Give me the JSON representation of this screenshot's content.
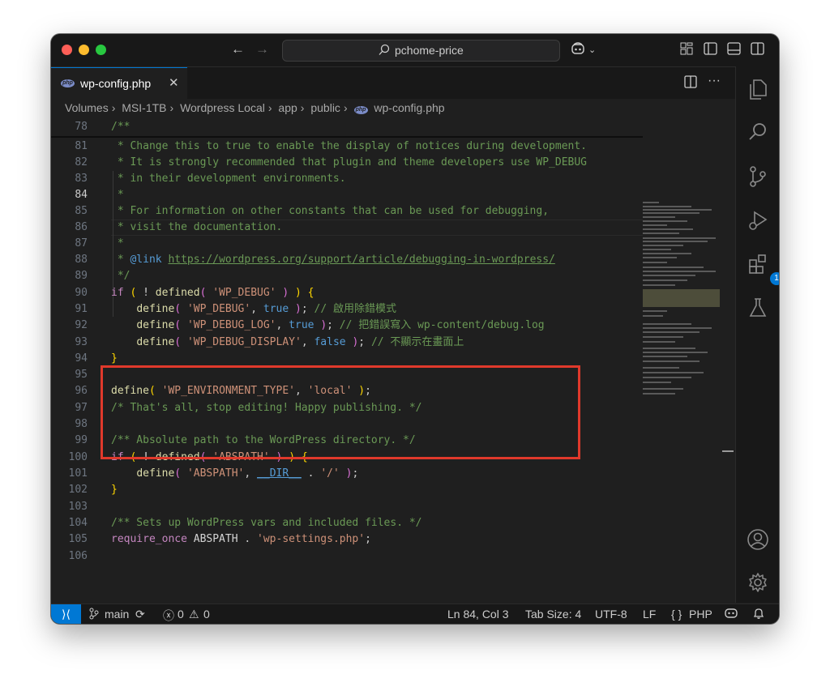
{
  "titlebar": {
    "search_text": "pchome-price",
    "back_icon": "arrow-left-icon",
    "forward_icon": "arrow-right-icon",
    "copilot_icon": "copilot-icon"
  },
  "tab": {
    "label": "wp-config.php",
    "file_badge": "php"
  },
  "breadcrumb": [
    "Volumes",
    "MSI-1TB",
    "Wordpress Local",
    "app",
    "public",
    "wp-config.php"
  ],
  "gutter": [
    "78",
    "81",
    "82",
    "83",
    "84",
    "85",
    "86",
    "87",
    "88",
    "89",
    "90",
    "91",
    "92",
    "93",
    "94",
    "95",
    "96",
    "97",
    "98",
    "99",
    "100",
    "101",
    "102",
    "103",
    "104",
    "105",
    "106"
  ],
  "active_line": "84",
  "code": {
    "l78": "/**",
    "l81": " * Change this to true to enable the display of notices during development.",
    "l82": " * It is strongly recommended that plugin and theme developers use WP_DEBUG",
    "l83": " * in their development environments.",
    "l84": " *",
    "l85": " * For information on other constants that can be used for debugging,",
    "l86": " * visit the documentation.",
    "l87": " *",
    "l88_prefix": " * ",
    "l88_tag": "@link",
    "l88_url": "https://wordpress.org/support/article/debugging-in-wordpress/",
    "l89": " */",
    "if": "if",
    "not": "!",
    "defined": "defined",
    "define": "define",
    "wp_debug": "'WP_DEBUG'",
    "wp_debug_log": "'WP_DEBUG_LOG'",
    "wp_debug_display": "'WP_DEBUG_DISPLAY'",
    "true": "true",
    "false": "false",
    "c91": "// 啟用除錯模式",
    "c92": "// 把錯誤寫入 wp-content/debug.log",
    "c93": "// 不顯示在畫面上",
    "wp_env_type": "'WP_ENVIRONMENT_TYPE'",
    "local": "'local'",
    "l97": "/* That's all, stop editing! Happy publishing. */",
    "l99": "/** Absolute path to the WordPress directory. */",
    "abspath_str": "'ABSPATH'",
    "dir": "__DIR__",
    "slash": "'/'",
    "l104": "/** Sets up WordPress vars and included files. */",
    "require_once": "require_once",
    "abspath_const": "ABSPATH",
    "wp_settings": "'wp-settings.php'"
  },
  "activity_bar": {
    "items": [
      "explorer-icon",
      "search-icon",
      "source-control-icon",
      "run-debug-icon",
      "extensions-icon",
      "testing-icon"
    ],
    "extensions_badge": "1",
    "bottom": [
      "account-icon",
      "settings-gear-icon"
    ]
  },
  "status_bar": {
    "branch": "main",
    "errors": "0",
    "warnings": "0",
    "position": "Ln 84, Col 3",
    "tab_size": "Tab Size: 4",
    "encoding": "UTF-8",
    "eol": "LF",
    "language_prefix": "{ }",
    "language": "PHP"
  },
  "colors": {
    "accent": "#0078d4",
    "highlight_box": "#e0392b",
    "editor_bg": "#1f1f1f"
  }
}
